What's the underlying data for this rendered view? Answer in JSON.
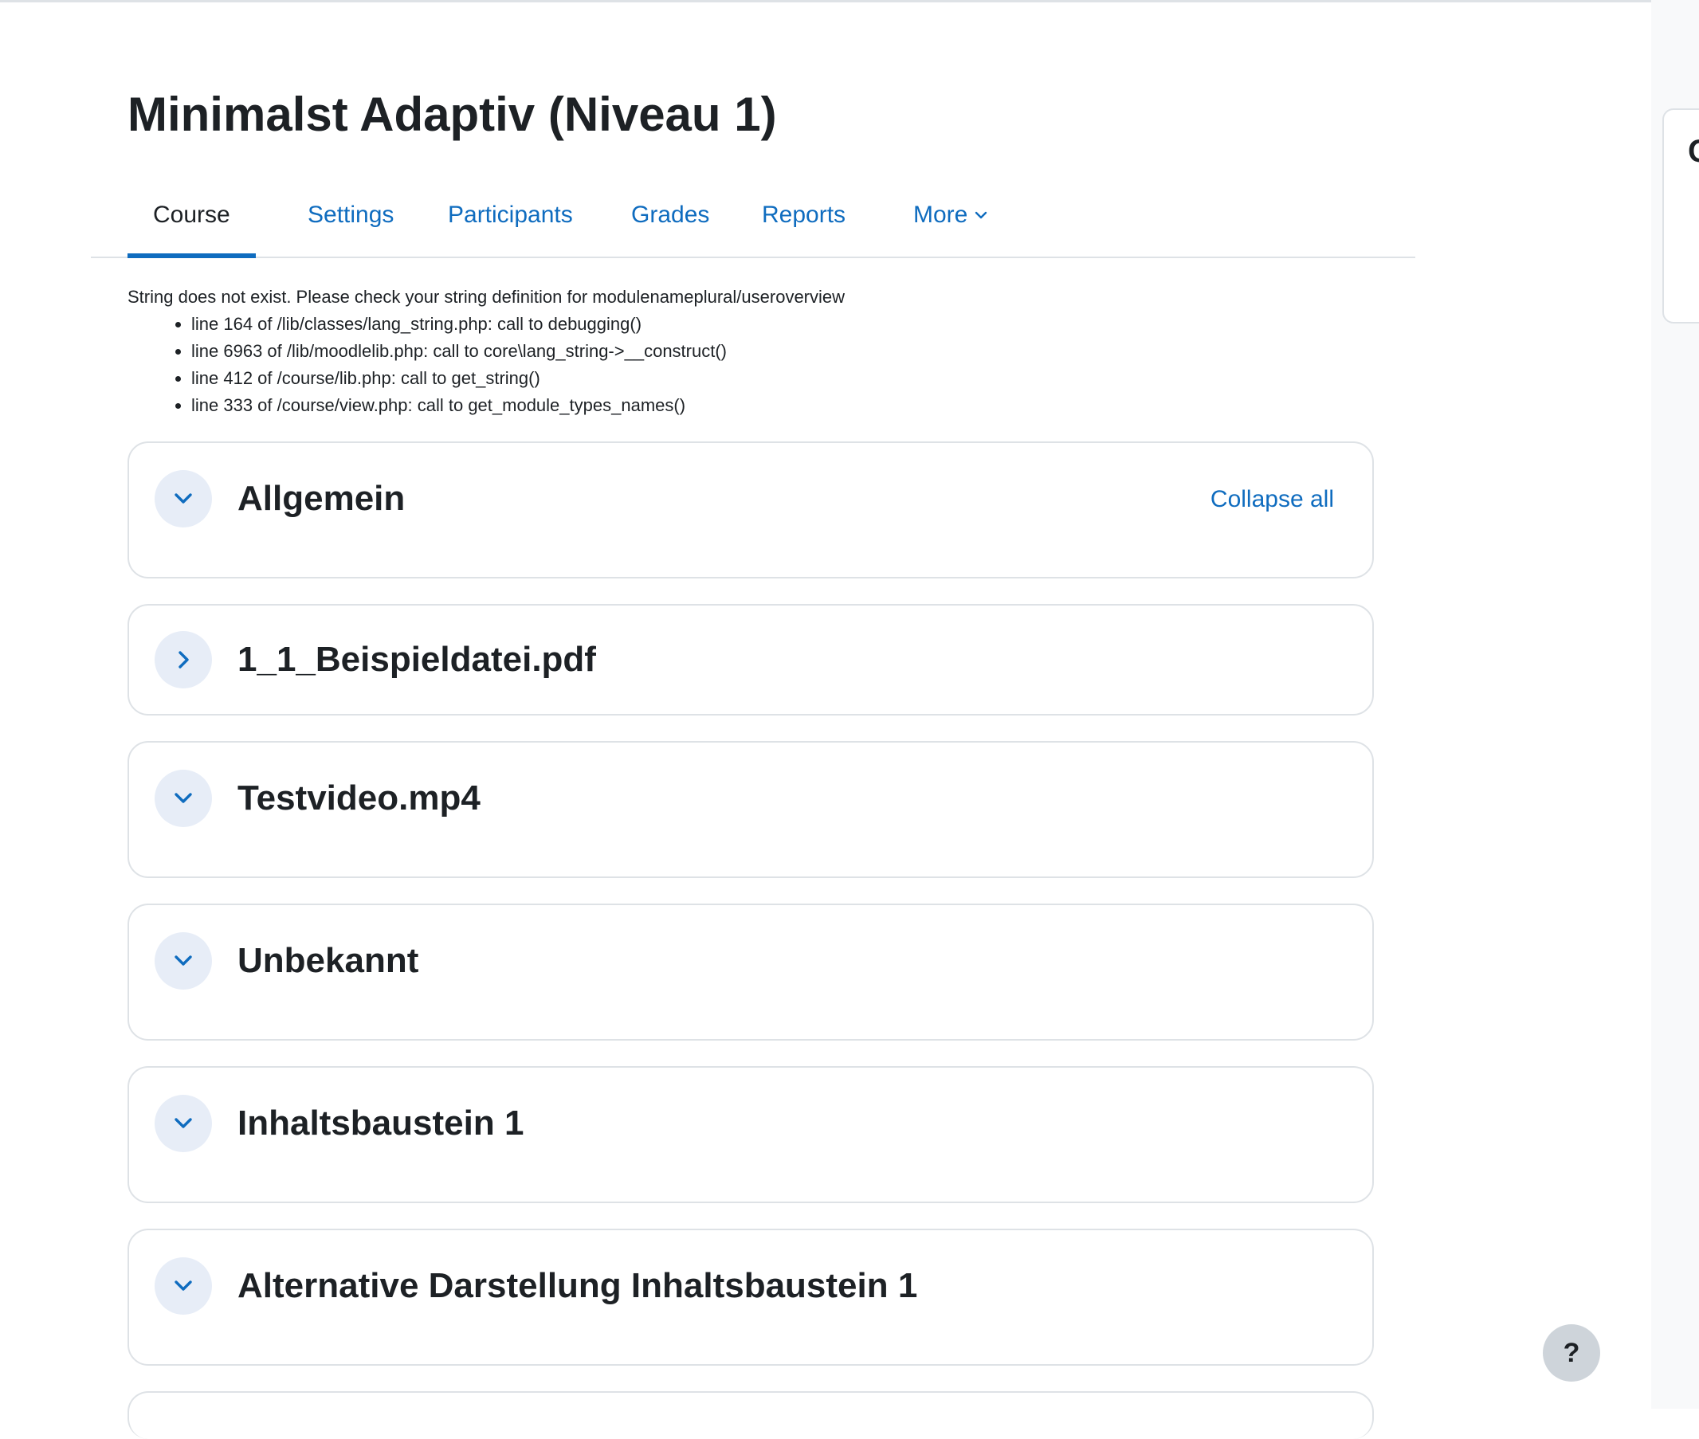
{
  "page": {
    "title": "Minimalst Adaptiv (Niveau 1)"
  },
  "drawer": {
    "label": "C"
  },
  "tabs": [
    {
      "label": "Course",
      "active": true
    },
    {
      "label": "Settings"
    },
    {
      "label": "Participants"
    },
    {
      "label": "Grades"
    },
    {
      "label": "Reports"
    },
    {
      "label": "More"
    }
  ],
  "debug": {
    "message": "String does not exist. Please check your string definition for modulenameplural/useroverview",
    "trace": [
      "line 164 of /lib/classes/lang_string.php: call to debugging()",
      "line 6963 of /lib/moodlelib.php: call to core\\lang_string->__construct()",
      "line 412 of /course/lib.php: call to get_string()",
      "line 333 of /course/view.php: call to get_module_types_names()"
    ]
  },
  "sections": [
    {
      "title": "Allgemein",
      "expanded": true
    },
    {
      "title": "1_1_Beispieldatei.pdf",
      "expanded": false
    },
    {
      "title": "Testvideo.mp4",
      "expanded": true
    },
    {
      "title": "Unbekannt",
      "expanded": true
    },
    {
      "title": "Inhaltsbaustein 1",
      "expanded": true
    },
    {
      "title": "Alternative Darstellung Inhaltsbaustein 1",
      "expanded": true
    }
  ],
  "collapse_all_label": "Collapse all",
  "help_label": "?",
  "colors": {
    "link": "#0f6cbf",
    "text": "#1d2125",
    "border": "#dee2e6",
    "toggle_bg": "#e7edf7"
  }
}
